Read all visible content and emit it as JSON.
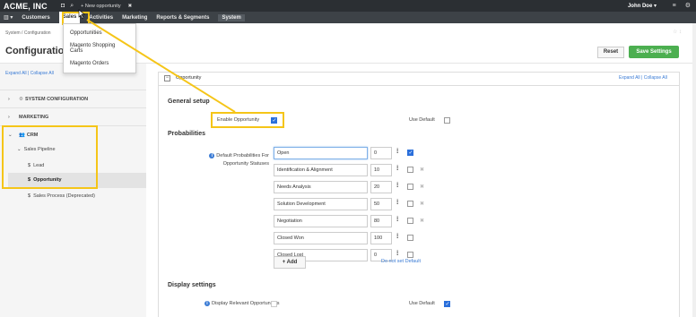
{
  "topbar": {
    "brand": "ACME, INC",
    "new_item": "+ New opportunity",
    "user": "John Doe",
    "user_caret": "▾",
    "menu_glyph": "≡",
    "gear_glyph": "⚙"
  },
  "menubar": {
    "items": [
      "Customers",
      "Sales",
      "Activities",
      "Marketing",
      "Reports & Segments",
      "System"
    ]
  },
  "dropdown": {
    "items": [
      "Opportunities",
      "Magento Shopping Carts",
      "Magento Orders"
    ]
  },
  "header": {
    "breadcrumb": "System / Configuration",
    "title": "Configuration",
    "reset": "Reset",
    "save": "Save Settings"
  },
  "sidebar": {
    "expand_links": "Expand All  |  Collapse All",
    "sections": [
      "SYSTEM CONFIGURATION",
      "MARKETING",
      "CRM"
    ],
    "sub": {
      "pipeline": "Sales Pipeline",
      "lead": "Lead",
      "opportunity": "Opportunity",
      "process": "Sales Process (Deprecated)"
    }
  },
  "panel": {
    "title": "Opportunity",
    "links": "Expand All  |  Collapse All"
  },
  "general": {
    "heading": "General setup",
    "enable_label": "Enable Opportunity",
    "use_default": "Use Default"
  },
  "probabilities": {
    "heading": "Probabilities",
    "label_line1": "Default Probabilities For",
    "label_line2": "Opportunity Statuses",
    "rows": [
      {
        "status": "Open",
        "value": "0"
      },
      {
        "status": "Identification & Alignment",
        "value": "10"
      },
      {
        "status": "Needs Analysis",
        "value": "20"
      },
      {
        "status": "Solution Development",
        "value": "50"
      },
      {
        "status": "Negotiation",
        "value": "80"
      },
      {
        "status": "Closed Won",
        "value": "100"
      },
      {
        "status": "Closed Lost",
        "value": "0"
      }
    ],
    "add": "+ Add",
    "do_not_set_default": "Do not set Default"
  },
  "display": {
    "heading": "Display settings",
    "relevant_label": "Display Relevant Opportunities",
    "use_default": "Use Default"
  },
  "colors": {
    "accent": "#2a6fdb",
    "highlight": "#f5c518",
    "save_green": "#4caf50"
  }
}
